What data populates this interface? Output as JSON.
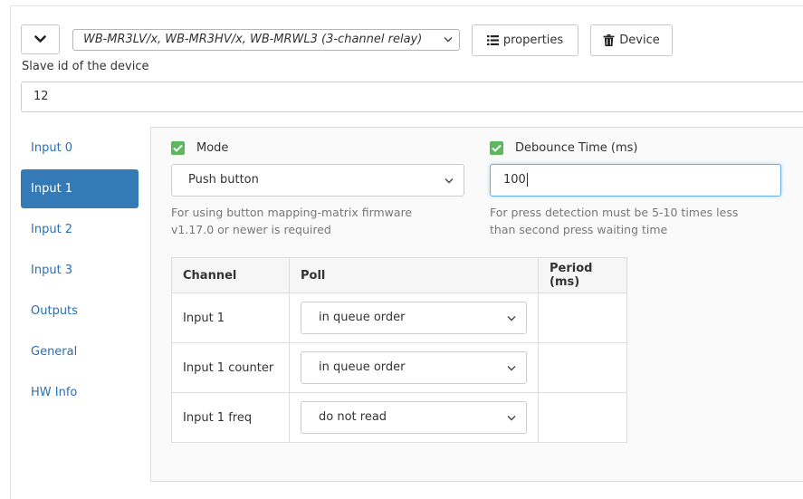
{
  "toolbar": {
    "device_model": "WB-MR3LV/x, WB-MR3HV/x, WB-MRWL3 (3-channel relay)",
    "properties_label": "properties",
    "device_label": "Device",
    "collapse_icon": "chevron-down-icon"
  },
  "slave": {
    "label": "Slave id of the device",
    "value": "12"
  },
  "tabs": [
    {
      "label": "Input 0",
      "active": false
    },
    {
      "label": "Input 1",
      "active": true
    },
    {
      "label": "Input 2",
      "active": false
    },
    {
      "label": "Input 3",
      "active": false
    },
    {
      "label": "Outputs",
      "active": false
    },
    {
      "label": "General",
      "active": false
    },
    {
      "label": "HW Info",
      "active": false
    }
  ],
  "mode": {
    "label": "Mode",
    "checked": true,
    "value": "Push button",
    "help": [
      "For using button mapping-matrix firmware",
      "v1.17.0 or newer is required"
    ]
  },
  "debounce": {
    "label": "Debounce Time (ms)",
    "checked": true,
    "value": "100",
    "help": [
      "For press detection must be 5-10 times less",
      "than second press waiting time"
    ]
  },
  "channels": {
    "headers": [
      "Channel",
      "Poll",
      "Period (ms)"
    ],
    "rows": [
      {
        "channel": "Input 1",
        "poll": "in queue order",
        "period": ""
      },
      {
        "channel": "Input 1 counter",
        "poll": "in queue order",
        "period": ""
      },
      {
        "channel": "Input 1 freq",
        "poll": "do not read",
        "period": ""
      }
    ]
  },
  "colors": {
    "accent": "#337ab7",
    "link": "#2c6fb0",
    "checkbox": "#5cb85c",
    "focus": "#66afe9"
  }
}
